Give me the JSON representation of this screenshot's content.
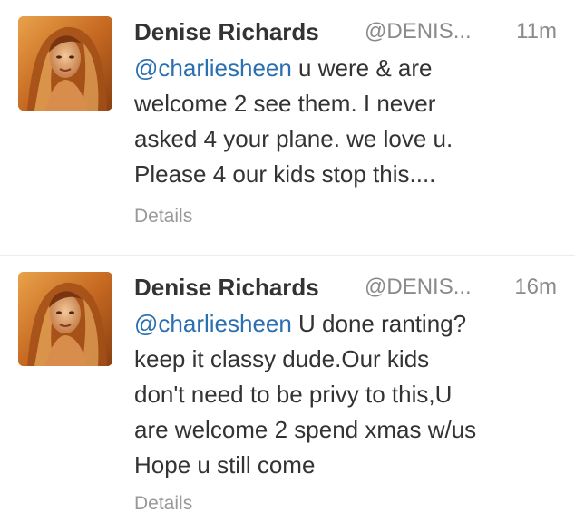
{
  "tweets": [
    {
      "author_name": "Denise Richards",
      "author_handle": "@DENIS...",
      "time": "11m",
      "lines": [
        {
          "mention": "@charliesheen",
          "rest": " u were & are"
        },
        {
          "mention": "",
          "rest": "welcome 2 see them.  I never"
        },
        {
          "mention": "",
          "rest": "asked 4 your plane. we love u."
        },
        {
          "mention": "",
          "rest": "Please 4 our kids stop this...."
        }
      ],
      "details_label": "Details",
      "avatar_icon": "profile-photo"
    },
    {
      "author_name": "Denise Richards",
      "author_handle": "@DENIS...",
      "time": "16m",
      "lines": [
        {
          "mention": "@charliesheen",
          "rest": " U done ranting?"
        },
        {
          "mention": "",
          "rest": "keep it classy dude.Our kids"
        },
        {
          "mention": "",
          "rest": "don't need to be privy to this,U"
        },
        {
          "mention": "",
          "rest": "are welcome 2 spend xmas w/us"
        },
        {
          "mention": "",
          "rest": "Hope u still come"
        }
      ],
      "details_label": "Details",
      "avatar_icon": "profile-photo"
    }
  ],
  "colors": {
    "text": "#333333",
    "muted": "#8a8a8a",
    "mention": "#2a6fb0"
  }
}
